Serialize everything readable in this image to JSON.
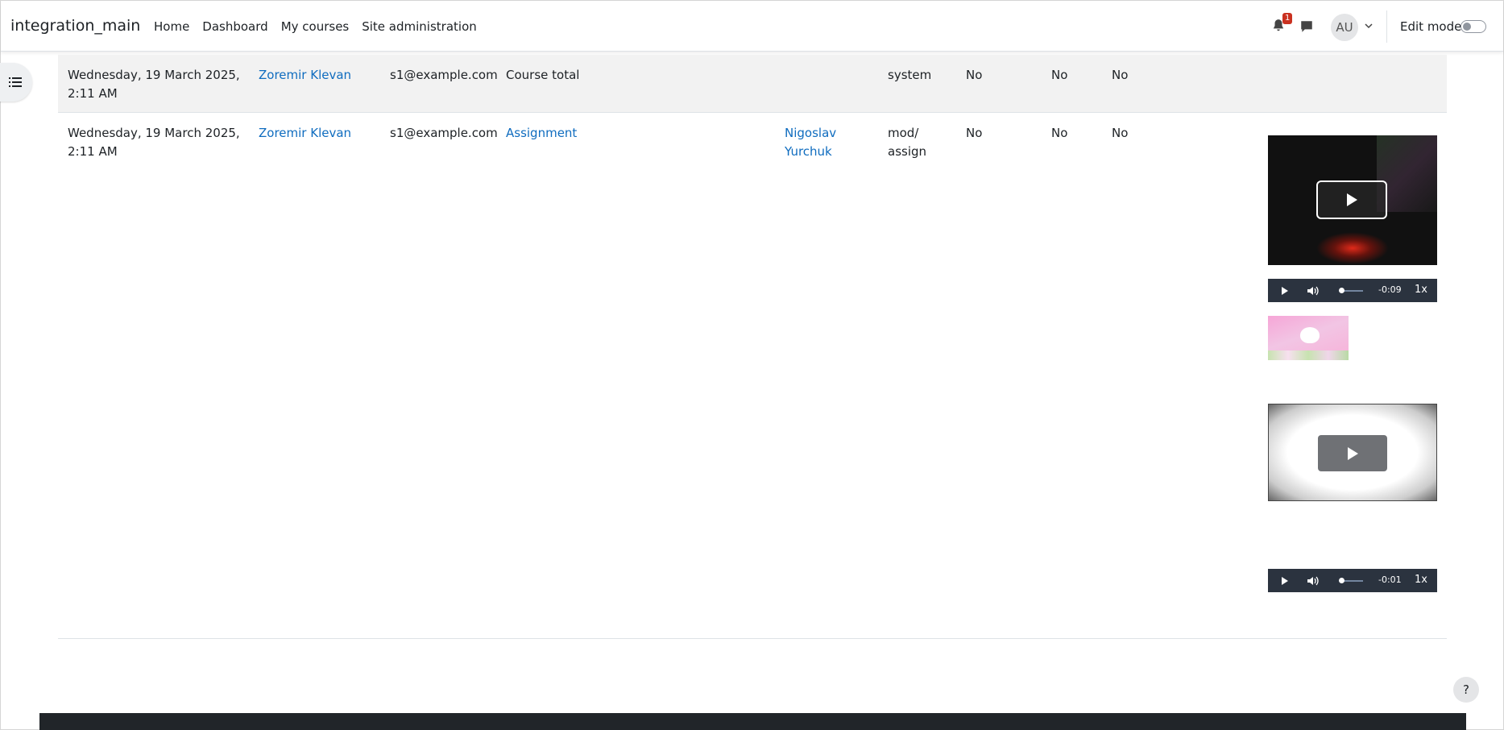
{
  "navbar": {
    "brand": "integration_main",
    "links": [
      "Home",
      "Dashboard",
      "My courses",
      "Site administration"
    ],
    "notification_count": "1",
    "avatar_initials": "AU",
    "edit_mode_label": "Edit mode"
  },
  "rows": [
    {
      "time_line1": "Wednesday, 19 March 2025,",
      "time_line2": "2:11 AM",
      "user": "Zoremir Klevan",
      "email": "s1@example.com",
      "item": "Course total",
      "grader_line1": "",
      "grader_line2": "",
      "source_line1": "system",
      "source_line2": "",
      "c1": "No",
      "c2": "No",
      "c3": "No"
    },
    {
      "time_line1": "Wednesday, 19 March 2025,",
      "time_line2": "2:11 AM",
      "user": "Zoremir Klevan",
      "email": "s1@example.com",
      "item": "Assignment",
      "grader_line1": "Nigoslav",
      "grader_line2": "Yurchuk",
      "source_line1": "mod/",
      "source_line2": "assign",
      "c1": "No",
      "c2": "No",
      "c3": "No"
    }
  ],
  "media": {
    "video1_time": "-0:09",
    "video1_speed": "1x",
    "video2_time": "-0:01",
    "video2_speed": "1x"
  },
  "help_label": "?",
  "colors": {
    "link": "#0f6cbf",
    "badge": "#ca3120",
    "player_bar": "#2b333f",
    "footer": "#212529"
  }
}
